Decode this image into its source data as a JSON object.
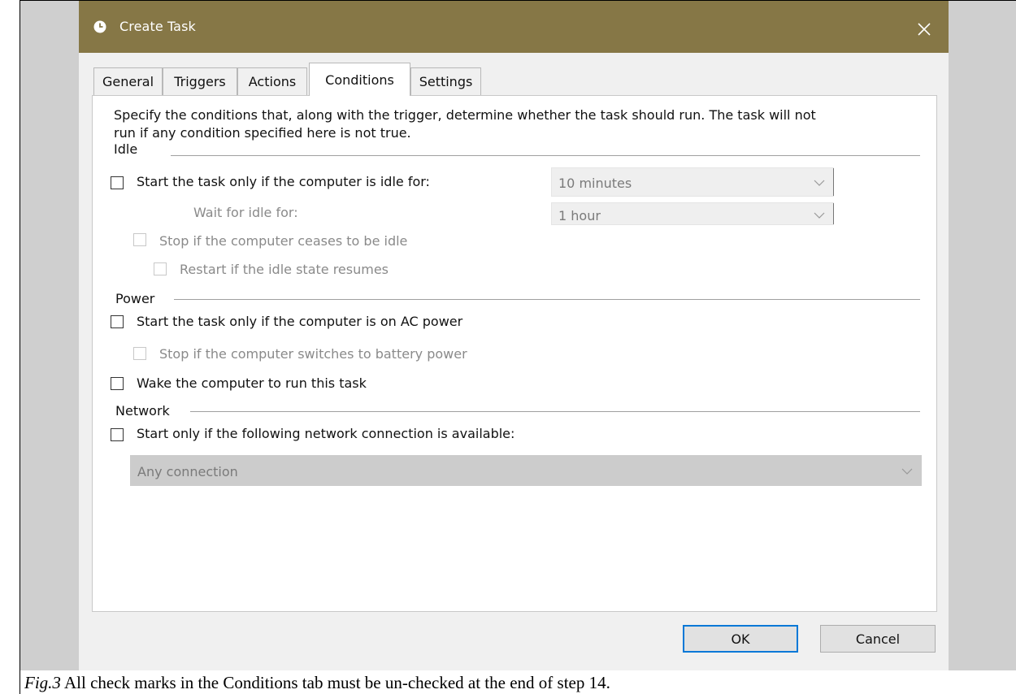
{
  "window": {
    "title": "Create Task",
    "icon": "clock-icon",
    "close_icon": "close-icon",
    "titlebar_color": "#867746"
  },
  "tabs": [
    {
      "label": "General"
    },
    {
      "label": "Triggers"
    },
    {
      "label": "Actions"
    },
    {
      "label": "Conditions",
      "active": true
    },
    {
      "label": "Settings"
    }
  ],
  "conditions": {
    "description_line1": "Specify the conditions that, along with the trigger, determine whether the task should run.  The task will not",
    "description_line2": "run  if any condition specified here is not true.",
    "idle": {
      "heading": "Idle",
      "start_if_idle": {
        "label": "Start the task only if the computer is idle for:",
        "checked": false
      },
      "idle_duration": {
        "value": "10 minutes"
      },
      "wait_label": "Wait for idle for:",
      "wait_duration": {
        "value": "1 hour"
      },
      "stop_if_ceases": {
        "label": "Stop if the computer ceases to be idle",
        "checked": false,
        "enabled": false
      },
      "restart_if_resumes": {
        "label": "Restart if the idle state resumes",
        "checked": false,
        "enabled": false
      }
    },
    "power": {
      "heading": "Power",
      "ac_power": {
        "label": "Start the task only if the computer is on AC power",
        "checked": false
      },
      "stop_on_battery": {
        "label": "Stop if the computer switches to battery power",
        "checked": false,
        "enabled": false
      },
      "wake": {
        "label": "Wake the computer to run this task",
        "checked": false
      }
    },
    "network": {
      "heading": "Network",
      "start_if_network": {
        "label": "Start only if the following network connection is available:",
        "checked": false
      },
      "connection": {
        "value": "Any connection"
      }
    }
  },
  "buttons": {
    "ok": "OK",
    "cancel": "Cancel"
  },
  "caption": {
    "fig": "Fig.3",
    "text": " All check marks in the Conditions tab must be un-checked at the end of step 14."
  }
}
